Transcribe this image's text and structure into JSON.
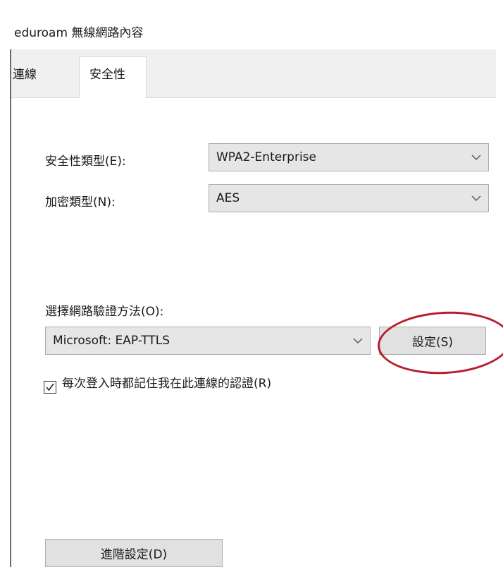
{
  "window": {
    "title": "eduroam 無線網路內容"
  },
  "tabs": [
    {
      "label": "連線",
      "active": false
    },
    {
      "label": "安全性",
      "active": true
    }
  ],
  "security": {
    "security_type_label": "安全性類型(E):",
    "security_type_value": "WPA2-Enterprise",
    "encryption_type_label": "加密類型(N):",
    "encryption_type_value": "AES",
    "auth_method_label": "選擇網路驗證方法(O):",
    "auth_method_value": "Microsoft: EAP-TTLS",
    "settings_button_label": "設定(S)",
    "remember_credentials_label": "每次登入時都記住我在此連線的認證(R)",
    "remember_credentials_checked": true,
    "advanced_button_label": "進階設定(D)"
  },
  "icons": {
    "dropdown": "chevron-down-icon",
    "checkbox": "checkmark-icon"
  },
  "colors": {
    "highlight_ring": "#b91c2c",
    "tab_strip": "#f0f0f0",
    "combo_bg": "#e6e6e6"
  }
}
